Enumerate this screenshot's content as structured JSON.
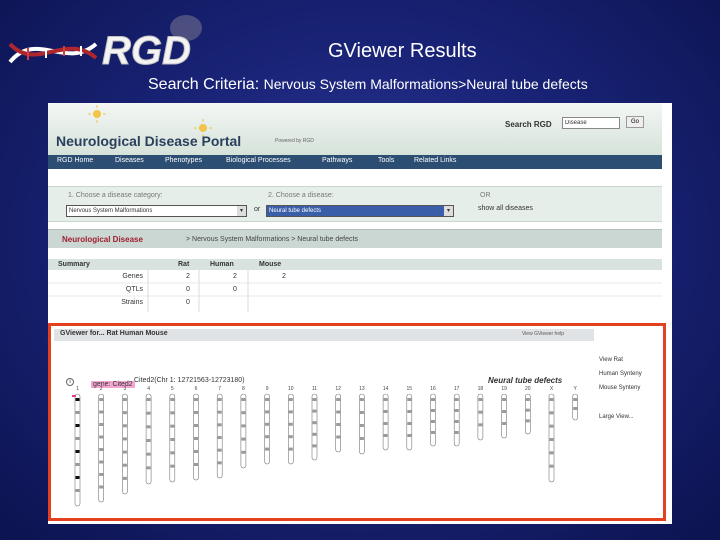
{
  "slide": {
    "title": "GViewer Results",
    "criteria_label": "Search Criteria:",
    "criteria_value": "Nervous System Malformations>Neural tube defects"
  },
  "logo": {
    "text": "RGD"
  },
  "portal": {
    "title": "Neurological Disease Portal",
    "powered_by": "Powered by RGD",
    "search_label": "Search RGD",
    "search_value": "Disease",
    "go_label": "Go",
    "nav": [
      "RGD Home",
      "Diseases",
      "Phenotypes",
      "Biological Processes",
      "Pathways",
      "Tools",
      "Related Links"
    ]
  },
  "category": {
    "step1_label": "1. Choose a disease category:",
    "step1_value": "Nervous System Malformations",
    "step2_label": "2. Choose a disease:",
    "step2_value": "Neural tube defects",
    "or1": "or",
    "or2": "OR",
    "show_all": "show all diseases"
  },
  "breadcrumb": {
    "first": "Neurological Disease",
    "rest": "> Nervous System Malformations > Neural tube defects"
  },
  "summary": {
    "headers": [
      "Summary",
      "Rat",
      "Human",
      "Mouse"
    ],
    "rows": [
      {
        "label": "Genes",
        "rat": "2",
        "human": "2",
        "mouse": "2"
      },
      {
        "label": "QTLs",
        "rat": "0",
        "human": "0",
        "mouse": ""
      },
      {
        "label": "Strains",
        "rat": "0",
        "human": "",
        "mouse": ""
      }
    ]
  },
  "gviewer": {
    "title": "GViewer for... Rat Human Mouse",
    "help": "View GViewer help",
    "gene_tag": "gene: Cited2",
    "gene_location": "Cited2(Chr 1: 12721563-12723180)",
    "disease_label": "Neural tube defects",
    "chromosomes": [
      "1",
      "2",
      "3",
      "4",
      "5",
      "6",
      "7",
      "8",
      "9",
      "10",
      "11",
      "12",
      "13",
      "14",
      "15",
      "16",
      "17",
      "18",
      "19",
      "20",
      "X",
      "Y"
    ],
    "side_links": [
      "View Rat",
      "Human Synteny",
      "Mouse Synteny",
      "Large View..."
    ]
  },
  "colors": {
    "frame": "#e2401e",
    "nav_bg": "#2c4e73",
    "gene_tag": "#f4a6d2",
    "title": "#ffffff"
  }
}
